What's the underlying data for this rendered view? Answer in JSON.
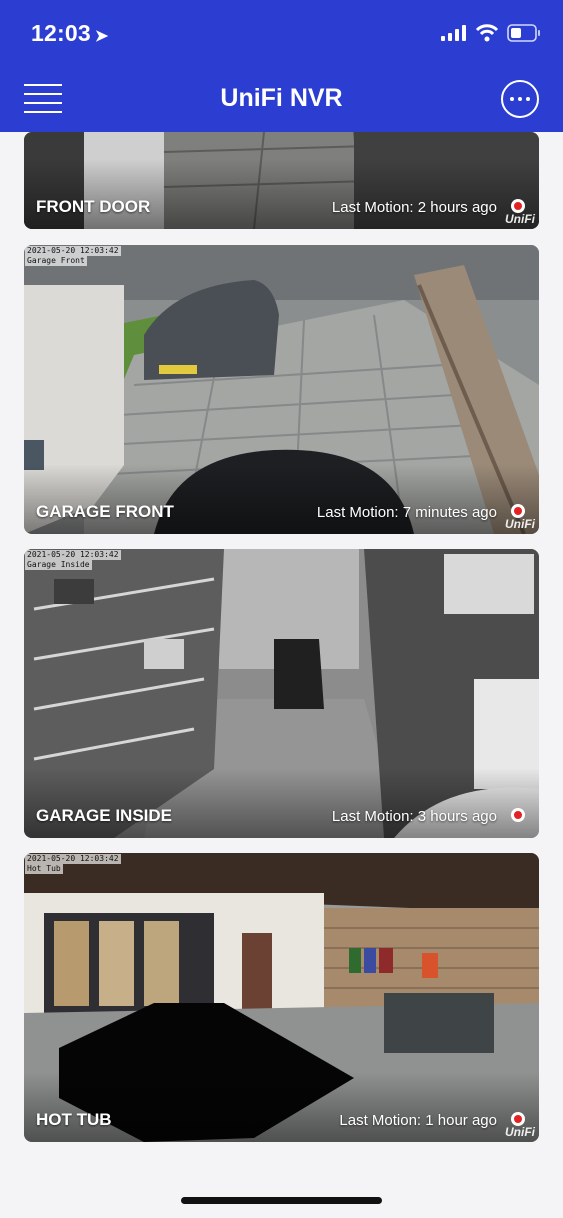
{
  "status_bar": {
    "time": "12:03",
    "location_glyph": "➤"
  },
  "nav": {
    "title": "UniFi NVR",
    "menu_icon": "hamburger-menu-icon",
    "more_icon": "more-options-icon"
  },
  "cameras": [
    {
      "name": "FRONT DOOR",
      "last_motion": "Last Motion: 2 hours ago",
      "timestamp": "",
      "overlay_label": ""
    },
    {
      "name": "GARAGE FRONT",
      "last_motion": "Last Motion: 7 minutes ago",
      "timestamp": "2021-05-20 12:03:42",
      "overlay_label": "Garage Front"
    },
    {
      "name": "GARAGE INSIDE",
      "last_motion": "Last Motion: 3 hours ago",
      "timestamp": "2021-05-20 12:03:42",
      "overlay_label": "Garage Inside"
    },
    {
      "name": "HOT TUB",
      "last_motion": "Last Motion: 1 hour ago",
      "timestamp": "2021-05-20 12:03:42",
      "overlay_label": "Hot Tub"
    }
  ],
  "brand_logo": "UniFi",
  "colors": {
    "header": "#2c3ed1",
    "recording_dot": "#e42222",
    "background": "#f4f4f6"
  }
}
